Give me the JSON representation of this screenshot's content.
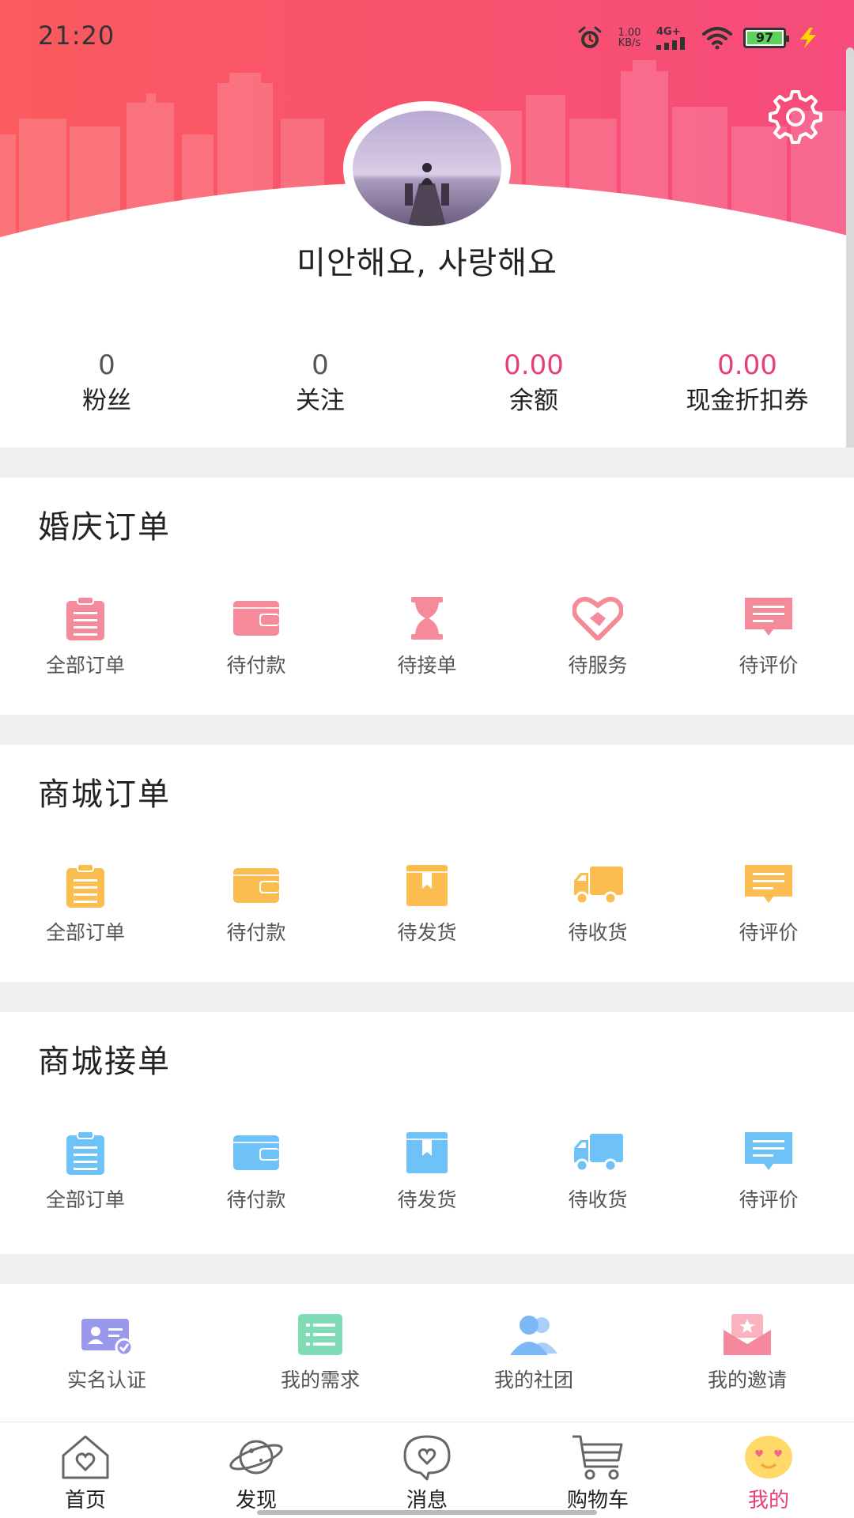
{
  "status_bar": {
    "time": "21:20",
    "net_speed_value": "1.00",
    "net_speed_unit": "KB/s",
    "network": "4G+",
    "battery": "97"
  },
  "profile": {
    "name": "미안해요, 사랑해요"
  },
  "stats": [
    {
      "value": "0",
      "label": "粉丝"
    },
    {
      "value": "0",
      "label": "关注"
    },
    {
      "value": "0.00",
      "label": "余额"
    },
    {
      "value": "0.00",
      "label": "现金折扣券"
    }
  ],
  "wedding_orders": {
    "title": "婚庆订单",
    "color": "#f58b9a",
    "items": [
      {
        "label": "全部订单",
        "icon": "clipboard-icon"
      },
      {
        "label": "待付款",
        "icon": "wallet-icon"
      },
      {
        "label": "待接单",
        "icon": "hourglass-icon"
      },
      {
        "label": "待服务",
        "icon": "handshake-heart-icon"
      },
      {
        "label": "待评价",
        "icon": "comment-icon"
      }
    ]
  },
  "mall_orders": {
    "title": "商城订单",
    "color": "#fbbd4f",
    "items": [
      {
        "label": "全部订单",
        "icon": "clipboard-icon"
      },
      {
        "label": "待付款",
        "icon": "wallet-icon"
      },
      {
        "label": "待发货",
        "icon": "box-icon"
      },
      {
        "label": "待收货",
        "icon": "truck-icon"
      },
      {
        "label": "待评价",
        "icon": "comment-icon"
      }
    ]
  },
  "mall_accept": {
    "title": "商城接单",
    "color": "#6ec2f7",
    "items": [
      {
        "label": "全部订单",
        "icon": "clipboard-icon"
      },
      {
        "label": "待付款",
        "icon": "wallet-icon"
      },
      {
        "label": "待发货",
        "icon": "box-icon"
      },
      {
        "label": "待收货",
        "icon": "truck-icon"
      },
      {
        "label": "待评价",
        "icon": "comment-icon"
      }
    ]
  },
  "extras": [
    {
      "label": "实名认证",
      "icon": "id-card-icon",
      "color": "#9a98ea"
    },
    {
      "label": "我的需求",
      "icon": "list-icon",
      "color": "#7fdcb6"
    },
    {
      "label": "我的社团",
      "icon": "group-icon",
      "color": "#7cb8f5"
    },
    {
      "label": "我的邀请",
      "icon": "invitation-icon",
      "color": "#f6889e"
    }
  ],
  "tabs": [
    {
      "label": "首页",
      "icon": "home-icon"
    },
    {
      "label": "发现",
      "icon": "planet-icon"
    },
    {
      "label": "消息",
      "icon": "message-icon"
    },
    {
      "label": "购物车",
      "icon": "cart-icon"
    },
    {
      "label": "我的",
      "icon": "smiley-icon",
      "active": true
    }
  ],
  "colors": {
    "header_start": "#fb5a5e",
    "header_end": "#f64b7c",
    "accent": "#e83f73"
  }
}
